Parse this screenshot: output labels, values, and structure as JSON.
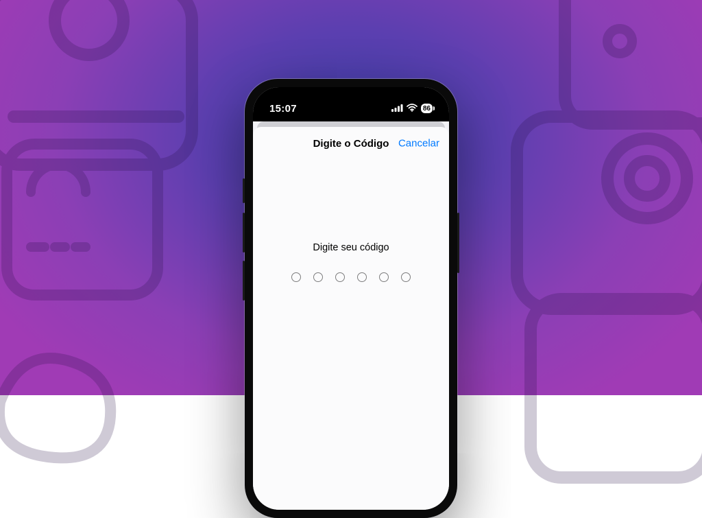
{
  "status_bar": {
    "time": "15:07",
    "battery_level": "86"
  },
  "modal": {
    "title": "Digite o Código",
    "cancel_label": "Cancelar"
  },
  "passcode": {
    "prompt": "Digite seu código",
    "digit_count": 6
  }
}
